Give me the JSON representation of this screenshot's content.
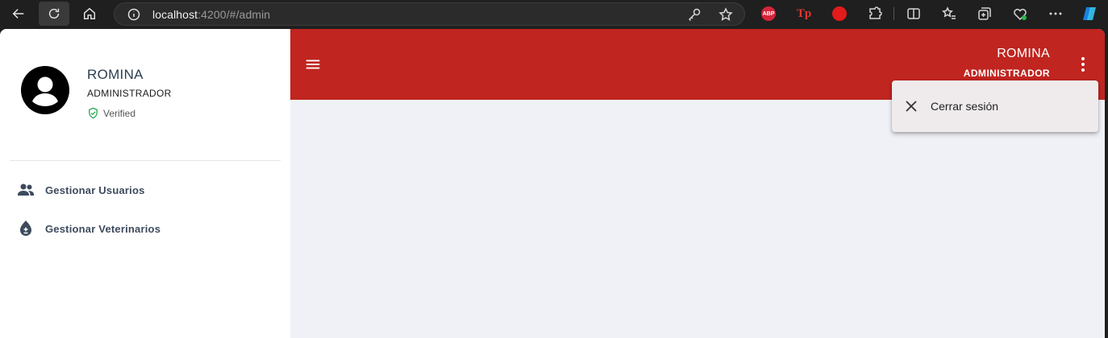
{
  "browser": {
    "url_host": "localhost",
    "url_path": ":4200/#/admin",
    "extensions": {
      "adblock_label": "ABP",
      "tp_label": "Tp"
    }
  },
  "sidebar": {
    "user_name": "ROMINA",
    "user_role": "ADMINISTRADOR",
    "verified_label": "Verified",
    "items": [
      {
        "label": "Gestionar Usuarios",
        "icon": "people-icon"
      },
      {
        "label": "Gestionar Veterinarios",
        "icon": "medical-drop-icon"
      }
    ]
  },
  "topbar": {
    "user_name": "ROMINA",
    "user_role": "ADMINISTRADOR"
  },
  "user_menu": {
    "items": [
      {
        "label": "Cerrar sesión",
        "icon": "close-icon"
      }
    ]
  },
  "colors": {
    "topbar": "#c02520",
    "content_bg": "#eff1f6",
    "verified": "#22a552",
    "sidebar_text": "#3d4a5c"
  }
}
